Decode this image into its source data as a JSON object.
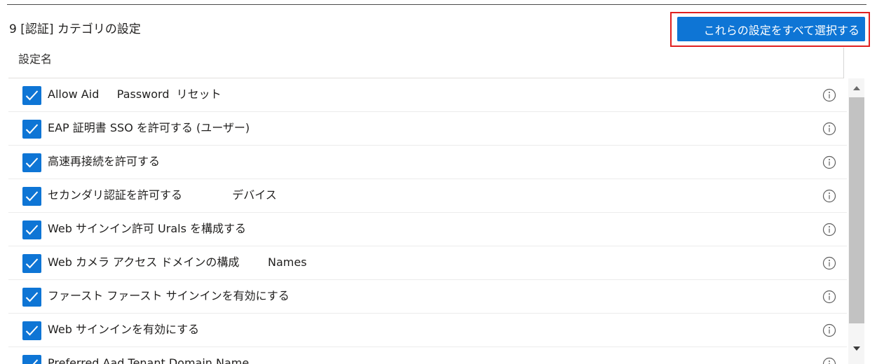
{
  "header": {
    "title": "9 [認証] カテゴリの設定",
    "select_all_label": "これらの設定をすべて選択する",
    "column_name": "設定名"
  },
  "settings": [
    {
      "label": "Allow Aid     Password  リセット",
      "checked": true
    },
    {
      "label": "EAP 証明書 SSO を許可する (ユーザー)",
      "checked": true
    },
    {
      "label": "高速再接続を許可する",
      "checked": true
    },
    {
      "label": "セカンダリ認証を許可する              デバイス",
      "checked": true
    },
    {
      "label": "Web サインイン許可 Urals を構成する",
      "checked": true
    },
    {
      "label": "Web カメラ アクセス ドメインの構成        Names",
      "checked": true
    },
    {
      "label": "ファースト ファースト サインインを有効にする",
      "checked": true
    },
    {
      "label": "Web サインインを有効にする",
      "checked": true
    },
    {
      "label": "Preferred Aad Tenant Domain Name",
      "checked": true
    }
  ],
  "icons": {
    "checkbox": "checkmark-icon",
    "info": "info-icon",
    "scroll_up": "scroll-up-arrow-icon",
    "scroll_down": "scroll-down-arrow-icon"
  },
  "colors": {
    "accent": "#0e75d5",
    "highlight": "#e02020"
  }
}
